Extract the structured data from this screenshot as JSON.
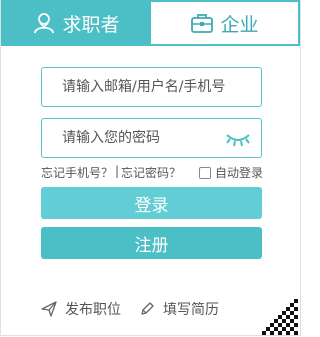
{
  "tabs": {
    "job_seeker": "求职者",
    "company": "企业"
  },
  "login": {
    "username_placeholder": "请输入邮箱/用户名/手机号",
    "password_placeholder": "请输入您的密码",
    "forgot_phone": "忘记手机号？",
    "separator": "|",
    "forgot_password": "忘记密码？",
    "auto_login": "自动登录",
    "login_button": "登录",
    "register_button": "注册"
  },
  "actions": {
    "post_job": "发布职位",
    "fill_resume": "填写简历"
  },
  "colors": {
    "accent": "#4bbec6",
    "accent_light": "#62cdd4"
  },
  "icons": {
    "job_tab": "person-icon",
    "company_tab": "briefcase-icon",
    "password_toggle": "closed-eye-icon",
    "post_job": "send-icon",
    "fill_resume": "pencil-icon",
    "corner": "qr-code-icon"
  }
}
